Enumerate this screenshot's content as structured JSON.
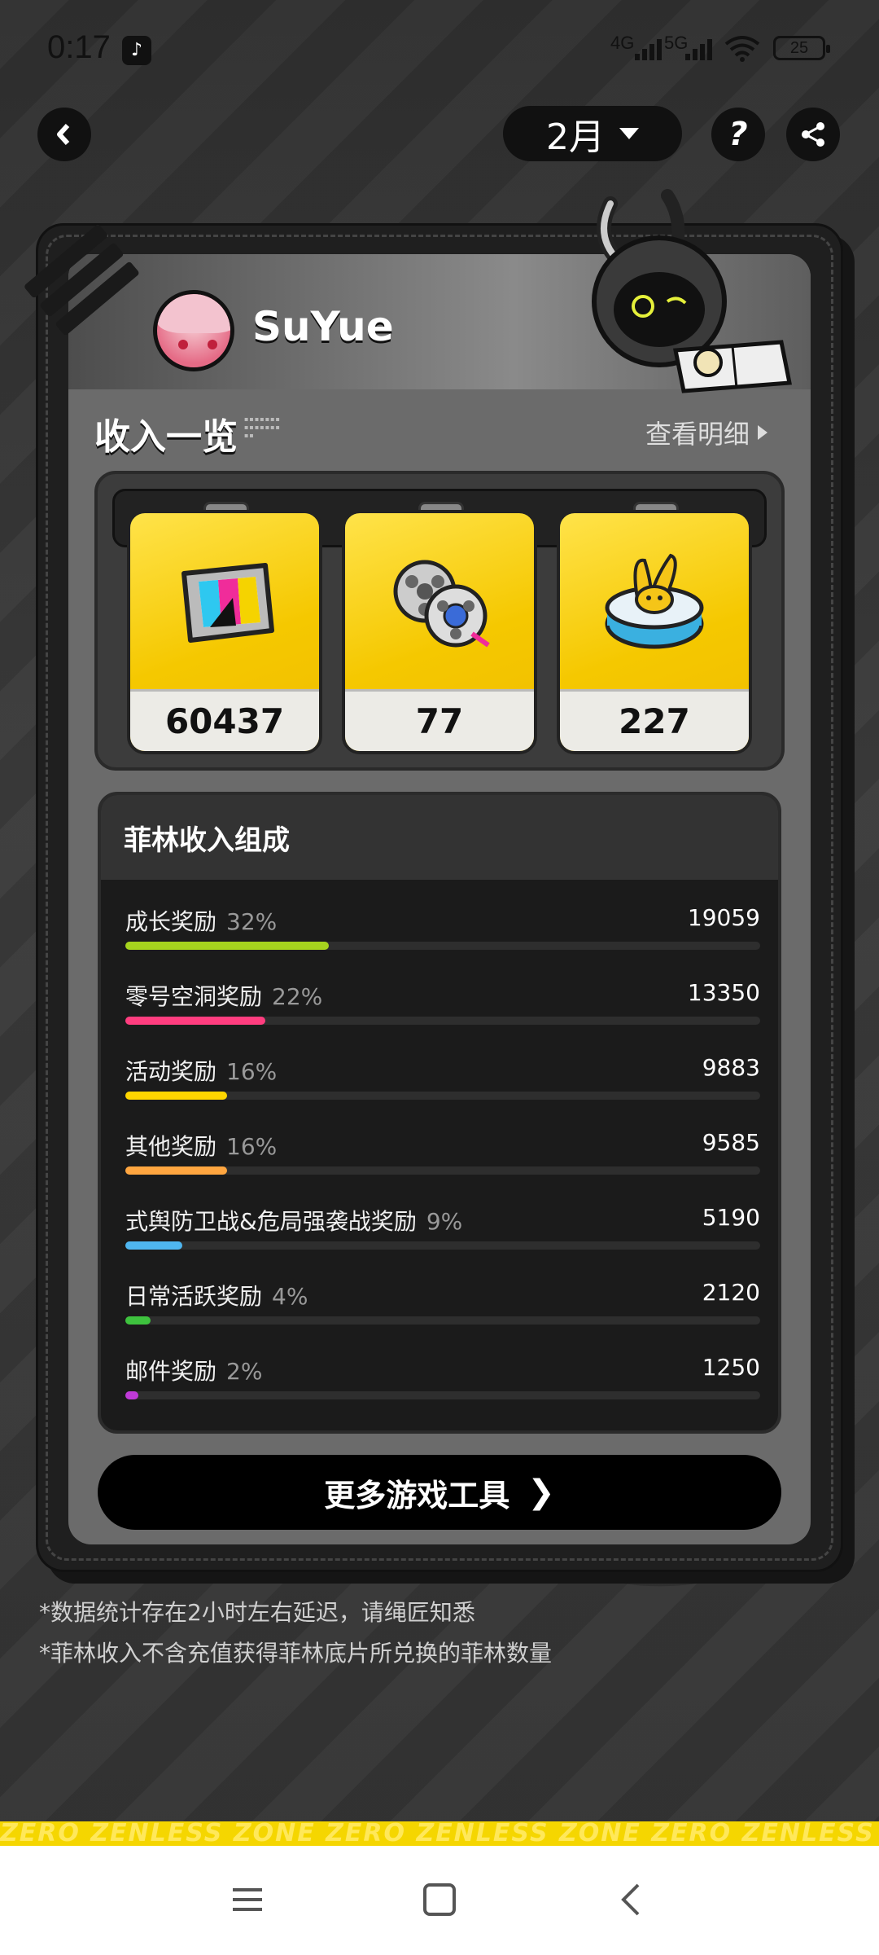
{
  "status_bar": {
    "time": "0:17",
    "network_1": "4G",
    "network_2": "5G",
    "battery": "25"
  },
  "top": {
    "month": "2月"
  },
  "profile": {
    "username": "SuYue"
  },
  "income": {
    "title": "收入一览",
    "view_detail": "查看明细"
  },
  "tickets": [
    {
      "icon": "film-reel-icon",
      "value": "60437"
    },
    {
      "icon": "film-spools-icon",
      "value": "77"
    },
    {
      "icon": "bangboo-base-icon",
      "value": "227"
    }
  ],
  "breakdown": {
    "title": "菲林收入组成",
    "rows": [
      {
        "label": "成长奖励",
        "percent": "32%",
        "value": "19059",
        "fraction": 0.32,
        "color": "#a6d41e"
      },
      {
        "label": "零号空洞奖励",
        "percent": "22%",
        "value": "13350",
        "fraction": 0.22,
        "color": "#ff3d7f"
      },
      {
        "label": "活动奖励",
        "percent": "16%",
        "value": "9883",
        "fraction": 0.16,
        "color": "#ffd600"
      },
      {
        "label": "其他奖励",
        "percent": "16%",
        "value": "9585",
        "fraction": 0.16,
        "color": "#ffa640"
      },
      {
        "label": "式舆防卫战&危局强袭战奖励",
        "percent": "9%",
        "value": "5190",
        "fraction": 0.09,
        "color": "#4fb6f0"
      },
      {
        "label": "日常活跃奖励",
        "percent": "4%",
        "value": "2120",
        "fraction": 0.04,
        "color": "#3ec23e"
      },
      {
        "label": "邮件奖励",
        "percent": "2%",
        "value": "1250",
        "fraction": 0.02,
        "color": "#c03ad8"
      }
    ]
  },
  "more_tools": {
    "label": "更多游戏工具",
    "chevron": "❯"
  },
  "notes": [
    "*数据统计存在2小时左右延迟，请绳匠知悉",
    "*菲林收入不含充值获得菲林底片所兑换的菲林数量"
  ],
  "band_text": "ZERO ZENLESS ZONE ZERO ZENLESS ZONE ZERO ZENLESS ZONE ZERO Z"
}
